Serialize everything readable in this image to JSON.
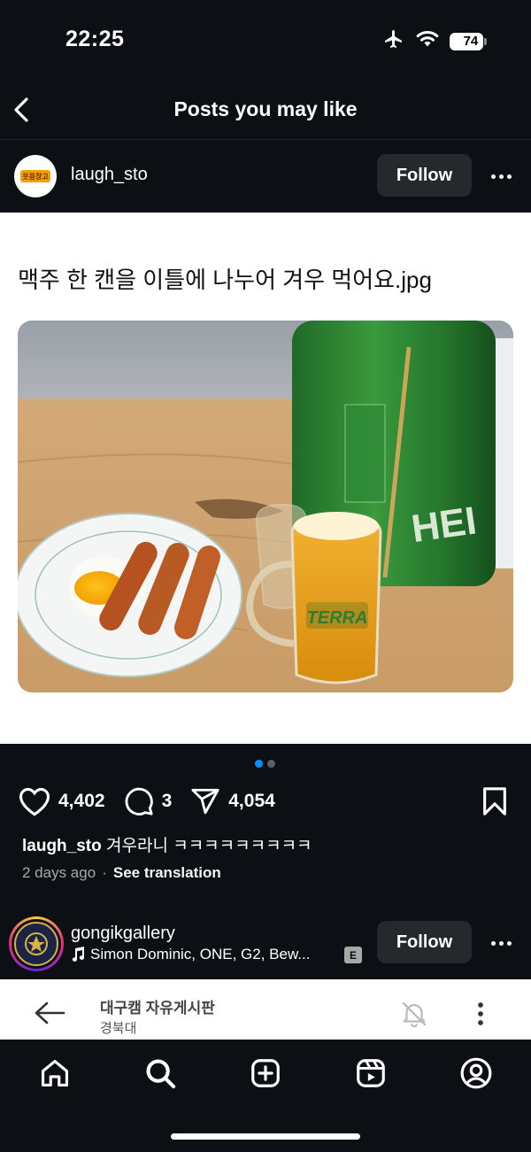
{
  "status_bar": {
    "time": "22:25",
    "battery": "74"
  },
  "header": {
    "title": "Posts you may like"
  },
  "post1": {
    "username": "laugh_sto",
    "avatar_text": "웃음창고",
    "follow_label": "Follow",
    "text": "맥주 한 캔을 이틀에 나누어 겨우 먹어요.jpg",
    "can_brand": "HEI",
    "glass_brand": "TERRA",
    "likes": "4,402",
    "comments": "3",
    "shares": "4,054",
    "caption_user": "laugh_sto",
    "caption_text": " 겨우라니 ㅋㅋㅋㅋㅋㅋㅋㅋㅋ",
    "time_ago": "2 days ago",
    "separator": "·",
    "see_translation": "See translation"
  },
  "carousel": {
    "active_color": "#0095f6",
    "inactive_color": "#5b6168"
  },
  "post2": {
    "username": "gongikgallery",
    "follow_label": "Follow",
    "music": "Simon Dominic, ONE, G2, Bew...",
    "explicit_tag": "E",
    "preview_title": "대구캠 자유게시판",
    "preview_sub": "경북대"
  },
  "icons": [
    "back-arrow-icon",
    "more-icon",
    "heart-icon",
    "comment-icon",
    "share-icon",
    "bookmark-icon",
    "music-note-icon",
    "home-icon",
    "search-icon",
    "create-icon",
    "reels-icon",
    "profile-icon"
  ]
}
